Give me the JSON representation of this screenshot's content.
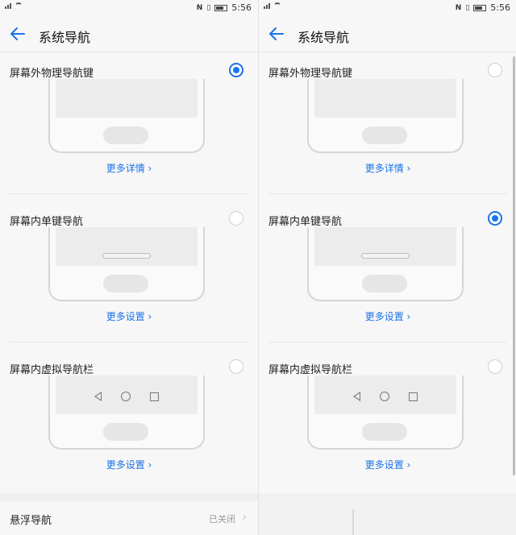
{
  "accent_color": "#1a73e8",
  "left": {
    "status": {
      "time": "5:56",
      "icons": [
        "signal-icon",
        "wifi-icon",
        "nfc-icon",
        "vibrate-icon",
        "battery-icon"
      ]
    },
    "header": {
      "title": "系统导航"
    },
    "options": [
      {
        "label": "屏幕外物理导航键",
        "selected": true,
        "link": "更多详情 ›"
      },
      {
        "label": "屏幕内单键导航",
        "selected": false,
        "link": "更多设置 ›"
      },
      {
        "label": "屏幕内虚拟导航栏",
        "selected": false,
        "link": "更多设置 ›"
      }
    ],
    "floating": {
      "label": "悬浮导航",
      "status": "已关闭",
      "chevron": "›"
    }
  },
  "right": {
    "status": {
      "time": "5:56"
    },
    "header": {
      "title": "系统导航"
    },
    "options": [
      {
        "label": "屏幕外物理导航键",
        "selected": false,
        "link": "更多详情 ›"
      },
      {
        "label": "屏幕内单键导航",
        "selected": true,
        "link": "更多设置 ›"
      },
      {
        "label": "屏幕内虚拟导航栏",
        "selected": false,
        "link": "更多设置 ›"
      }
    ]
  }
}
